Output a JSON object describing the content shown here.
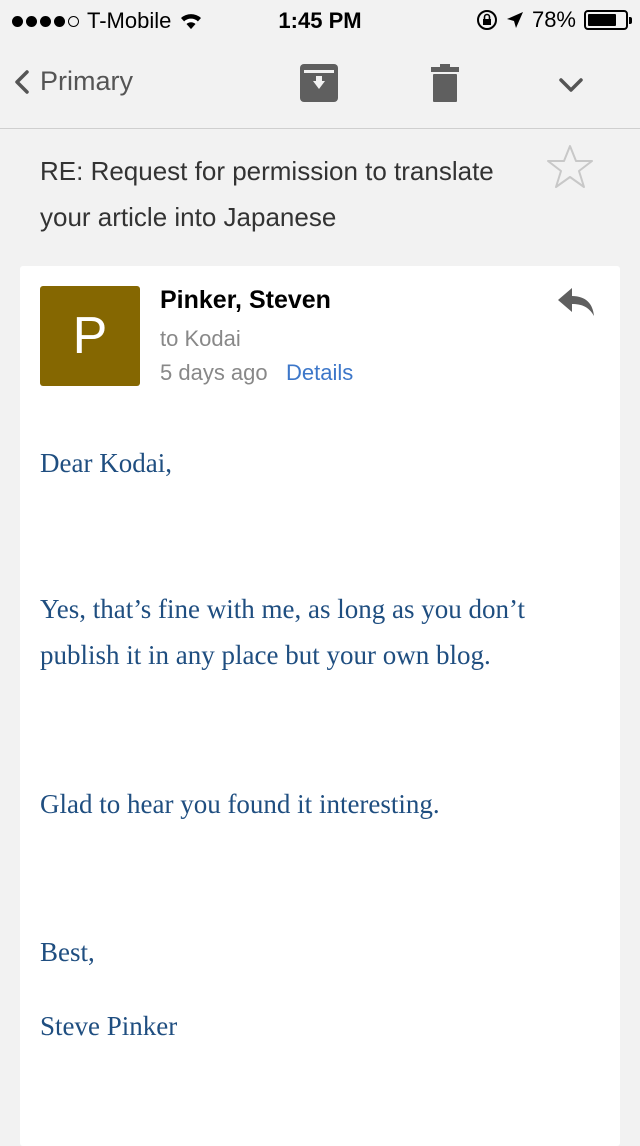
{
  "status_bar": {
    "carrier": "T-Mobile",
    "time": "1:45 PM",
    "battery_percent": "78%",
    "battery_level": 0.78,
    "signal_bars_filled": 4,
    "signal_bars_total": 5
  },
  "toolbar": {
    "back_label": "Primary",
    "icons": [
      "archive-icon",
      "trash-icon",
      "chevron-down-icon"
    ]
  },
  "subject": "RE: Request for permission to translate your article into Japanese",
  "message": {
    "avatar_letter": "P",
    "sender": "Pinker, Steven",
    "recipient": "to Kodai",
    "date": "5 days ago",
    "details_label": "Details",
    "body": {
      "greeting": "Dear Kodai,",
      "para1_line1": "Yes, that’s fine with me, as long as you don’t",
      "para1_line2": "publish it in any place but your own blog.",
      "para2": "Glad to hear you found it interesting.",
      "closing": "Best,",
      "signature": "Steve Pinker"
    }
  },
  "colors": {
    "avatar_bg": "#856701",
    "link": "#3d77c9",
    "body_text": "#1f4e80",
    "icon_gray": "#5f5f5f",
    "star_outline": "#c8c8c8"
  }
}
